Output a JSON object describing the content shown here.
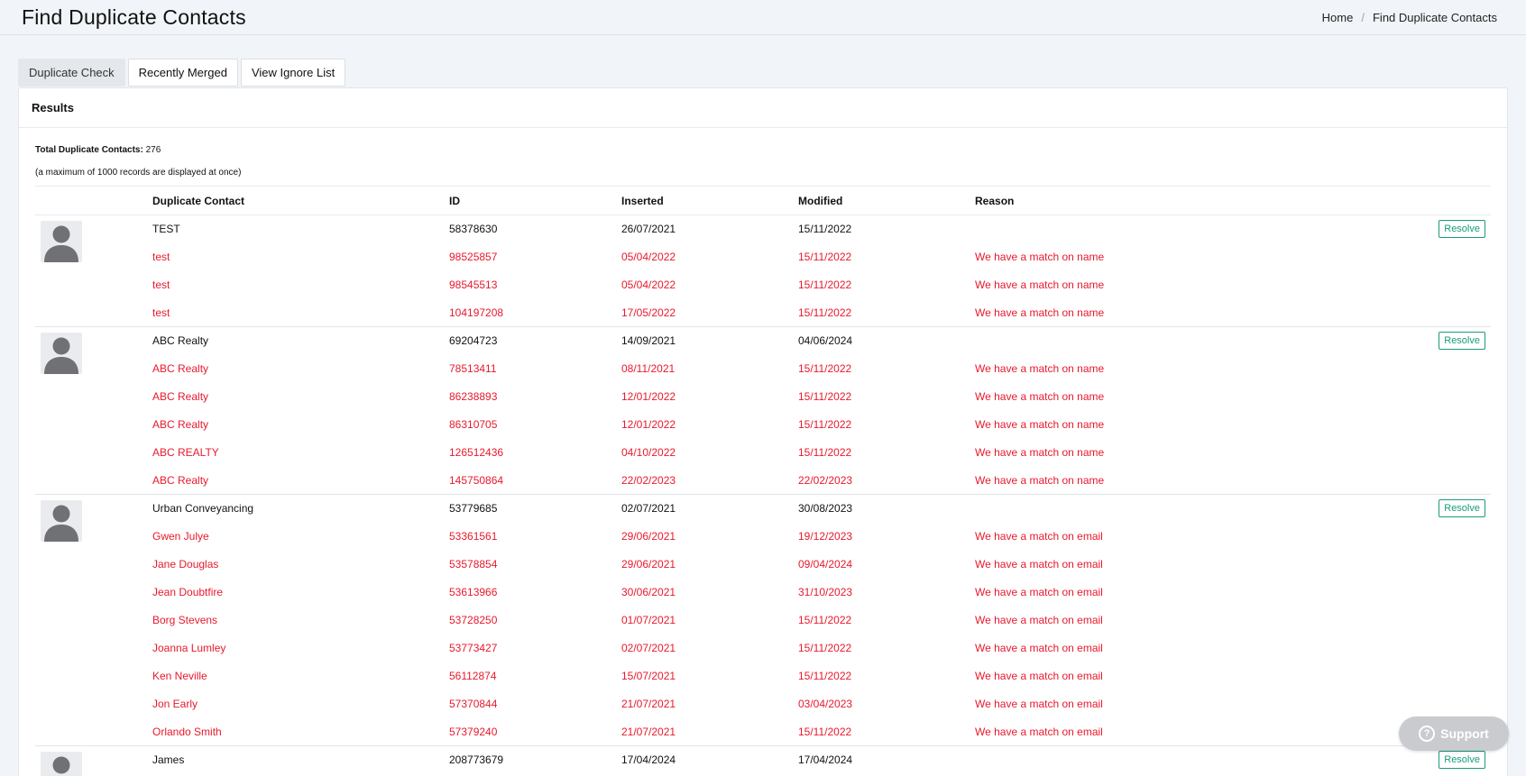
{
  "header": {
    "title": "Find Duplicate Contacts",
    "breadcrumb": {
      "home": "Home",
      "separator": "/",
      "current": "Find Duplicate Contacts"
    }
  },
  "tabs": [
    {
      "label": "Duplicate Check",
      "active": true
    },
    {
      "label": "Recently Merged",
      "active": false
    },
    {
      "label": "View Ignore List",
      "active": false
    }
  ],
  "results": {
    "title": "Results",
    "total_label": "Total Duplicate Contacts:",
    "total_value": "276",
    "note": "(a maximum of 1000 records are displayed at once)",
    "columns": [
      "Duplicate Contact",
      "ID",
      "Inserted",
      "Modified",
      "Reason"
    ],
    "resolve_label": "Resolve",
    "groups": [
      {
        "primary": {
          "name": "TEST",
          "id": "58378630",
          "inserted": "26/07/2021",
          "modified": "15/11/2022",
          "reason": ""
        },
        "duplicates": [
          {
            "name": "test",
            "id": "98525857",
            "inserted": "05/04/2022",
            "modified": "15/11/2022",
            "reason": "We have a match on name"
          },
          {
            "name": "test",
            "id": "98545513",
            "inserted": "05/04/2022",
            "modified": "15/11/2022",
            "reason": "We have a match on name"
          },
          {
            "name": "test",
            "id": "104197208",
            "inserted": "17/05/2022",
            "modified": "15/11/2022",
            "reason": "We have a match on name"
          }
        ]
      },
      {
        "primary": {
          "name": "ABC Realty",
          "id": "69204723",
          "inserted": "14/09/2021",
          "modified": "04/06/2024",
          "reason": ""
        },
        "duplicates": [
          {
            "name": "ABC Realty",
            "id": "78513411",
            "inserted": "08/11/2021",
            "modified": "15/11/2022",
            "reason": "We have a match on name"
          },
          {
            "name": "ABC Realty",
            "id": "86238893",
            "inserted": "12/01/2022",
            "modified": "15/11/2022",
            "reason": "We have a match on name"
          },
          {
            "name": "ABC Realty",
            "id": "86310705",
            "inserted": "12/01/2022",
            "modified": "15/11/2022",
            "reason": "We have a match on name"
          },
          {
            "name": "ABC REALTY",
            "id": "126512436",
            "inserted": "04/10/2022",
            "modified": "15/11/2022",
            "reason": "We have a match on name"
          },
          {
            "name": "ABC Realty",
            "id": "145750864",
            "inserted": "22/02/2023",
            "modified": "22/02/2023",
            "reason": "We have a match on name"
          }
        ]
      },
      {
        "primary": {
          "name": "Urban Conveyancing",
          "id": "53779685",
          "inserted": "02/07/2021",
          "modified": "30/08/2023",
          "reason": ""
        },
        "duplicates": [
          {
            "name": "Gwen Julye",
            "id": "53361561",
            "inserted": "29/06/2021",
            "modified": "19/12/2023",
            "reason": "We have a match on email"
          },
          {
            "name": "Jane Douglas",
            "id": "53578854",
            "inserted": "29/06/2021",
            "modified": "09/04/2024",
            "reason": "We have a match on email"
          },
          {
            "name": "Jean Doubtfire",
            "id": "53613966",
            "inserted": "30/06/2021",
            "modified": "31/10/2023",
            "reason": "We have a match on email"
          },
          {
            "name": "Borg Stevens",
            "id": "53728250",
            "inserted": "01/07/2021",
            "modified": "15/11/2022",
            "reason": "We have a match on email"
          },
          {
            "name": "Joanna Lumley",
            "id": "53773427",
            "inserted": "02/07/2021",
            "modified": "15/11/2022",
            "reason": "We have a match on email"
          },
          {
            "name": "Ken Neville",
            "id": "56112874",
            "inserted": "15/07/2021",
            "modified": "15/11/2022",
            "reason": "We have a match on email"
          },
          {
            "name": "Jon Early",
            "id": "57370844",
            "inserted": "21/07/2021",
            "modified": "03/04/2023",
            "reason": "We have a match on email"
          },
          {
            "name": "Orlando Smith",
            "id": "57379240",
            "inserted": "21/07/2021",
            "modified": "15/11/2022",
            "reason": "We have a match on email"
          }
        ]
      },
      {
        "primary": {
          "name": "James",
          "id": "208773679",
          "inserted": "17/04/2024",
          "modified": "17/04/2024",
          "reason": ""
        },
        "duplicates": []
      }
    ]
  },
  "support": {
    "label": "Support",
    "icon": "question-circle-icon"
  },
  "colors": {
    "duplicate_text": "#e8192c",
    "resolve_accent": "#1b9b7a",
    "page_bg": "#f1f4f8"
  }
}
